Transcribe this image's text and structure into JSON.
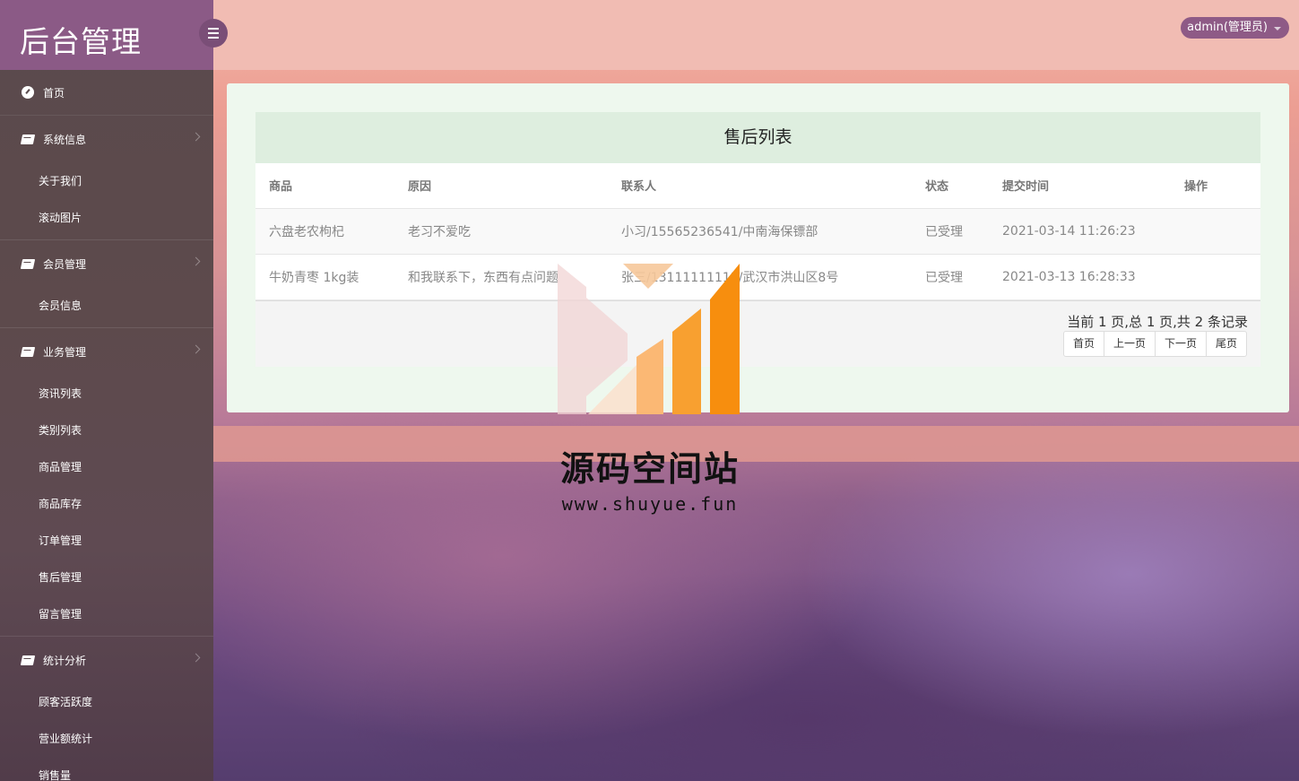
{
  "sidebar": {
    "brand": "后台管理",
    "home": "首页",
    "groups": [
      {
        "label": "系统信息",
        "items": [
          "关于我们",
          "滚动图片"
        ]
      },
      {
        "label": "会员管理",
        "items": [
          "会员信息"
        ]
      },
      {
        "label": "业务管理",
        "items": [
          "资讯列表",
          "类别列表",
          "商品管理",
          "商品库存",
          "订单管理",
          "售后管理",
          "留言管理"
        ]
      },
      {
        "label": "统计分析",
        "items": [
          "顾客活跃度",
          "营业额统计",
          "销售量"
        ]
      }
    ]
  },
  "header": {
    "user": "admin(管理员)"
  },
  "table": {
    "title": "售后列表",
    "columns": [
      "商品",
      "原因",
      "联系人",
      "状态",
      "提交时间",
      "操作"
    ],
    "rows": [
      [
        "六盘老农枸杞",
        "老习不爱吃",
        "小习/15565236541/中南海保镖部",
        "已受理",
        "2021-03-14 11:26:23",
        ""
      ],
      [
        "牛奶青枣 1kg装",
        "和我联系下，东西有点问题",
        "张三/13111111111/武汉市洪山区8号",
        "已受理",
        "2021-03-13 16:28:33",
        ""
      ]
    ]
  },
  "pager": {
    "info": "当前 1 页,总 1 页,共 2 条记录",
    "first": "首页",
    "prev": "上一页",
    "next": "下一页",
    "last": "尾页"
  },
  "watermark": {
    "title": "源码空间站",
    "url": "www.shuyue.fun"
  },
  "colors": {
    "brand": "#8b5a86",
    "sidebar": "#5a4a4d",
    "topbar": "#f1bcb3",
    "panel": "#eef8ee"
  }
}
